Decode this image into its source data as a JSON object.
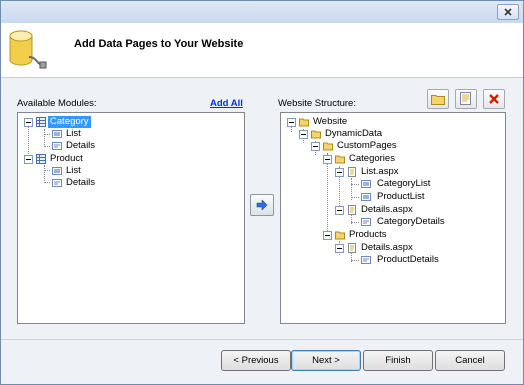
{
  "header": {
    "title": "Add Data Pages to Your Website"
  },
  "left_panel": {
    "label": "Available Modules:",
    "add_all": "Add All",
    "tree": [
      {
        "text": "Category",
        "selected": true
      },
      {
        "text": "List"
      },
      {
        "text": "Details"
      },
      {
        "text": "Product"
      },
      {
        "text": "List"
      },
      {
        "text": "Details"
      }
    ]
  },
  "right_panel": {
    "label": "Website Structure:",
    "tree": [
      {
        "text": "Website"
      },
      {
        "text": "DynamicData"
      },
      {
        "text": "CustomPages"
      },
      {
        "text": "Categories"
      },
      {
        "text": "List.aspx"
      },
      {
        "text": "CategoryList"
      },
      {
        "text": "ProductList"
      },
      {
        "text": "Details.aspx"
      },
      {
        "text": "CategoryDetails"
      },
      {
        "text": "Products"
      },
      {
        "text": "Details.aspx"
      },
      {
        "text": "ProductDetails"
      }
    ]
  },
  "buttons": {
    "previous": "< Previous",
    "next": "Next >",
    "finish": "Finish",
    "cancel": "Cancel"
  },
  "icons": {
    "close": "close-icon",
    "database": "database-icon",
    "new_folder": "new-folder-icon",
    "new_page": "new-page-icon",
    "delete": "delete-icon",
    "move_right": "arrow-right-icon"
  },
  "colors": {
    "accent": "#3399ff",
    "link": "#0033cc",
    "delete": "#cc2200"
  }
}
